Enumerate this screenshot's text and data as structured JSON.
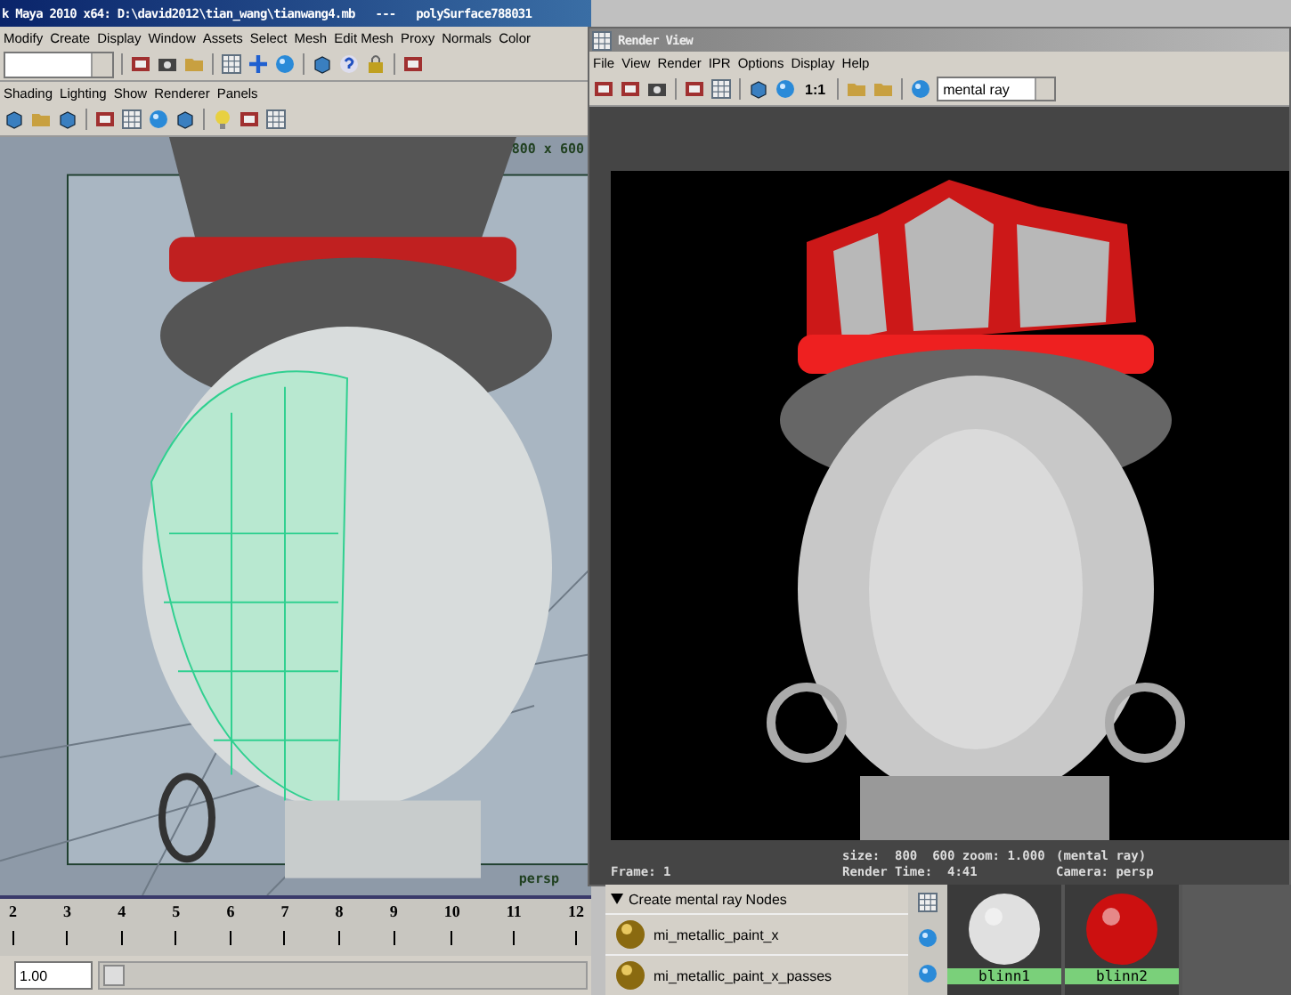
{
  "main_window": {
    "title": "k Maya 2010 x64: D:\\david2012\\tian_wang\\tianwang4.mb   ---   polySurface788031",
    "menu": [
      "Modify",
      "Create",
      "Display",
      "Window",
      "Assets",
      "Select",
      "Mesh",
      "Edit Mesh",
      "Proxy",
      "Normals",
      "Color"
    ],
    "panel_menu": [
      "Shading",
      "Lighting",
      "Show",
      "Renderer",
      "Panels"
    ],
    "viewport": {
      "resolution": "800 x 600",
      "camera": "persp"
    },
    "timeline": [
      "2",
      "3",
      "4",
      "5",
      "6",
      "7",
      "8",
      "9",
      "10",
      "11",
      "12"
    ],
    "range_start": "1.00",
    "range_slider": {
      "level": 0
    }
  },
  "render_view": {
    "title": "Render View",
    "menu": [
      "File",
      "View",
      "Render",
      "IPR",
      "Options",
      "Display",
      "Help"
    ],
    "zoom_button": "1:1",
    "renderer": "mental ray",
    "info": {
      "size": "size:  800  600 zoom: 1.000",
      "renderer": "(mental ray)",
      "frame": "Frame: 1",
      "render_time": "Render Time:  4:41",
      "camera": "Camera: persp"
    }
  },
  "hypershade": {
    "section": "Create mental ray Nodes",
    "nodes": [
      "mi_metallic_paint_x",
      "mi_metallic_paint_x_passes"
    ],
    "swatches": [
      {
        "label": "blinn1",
        "color": "#e0e0e0"
      },
      {
        "label": "blinn2",
        "color": "#cc1010"
      }
    ]
  }
}
